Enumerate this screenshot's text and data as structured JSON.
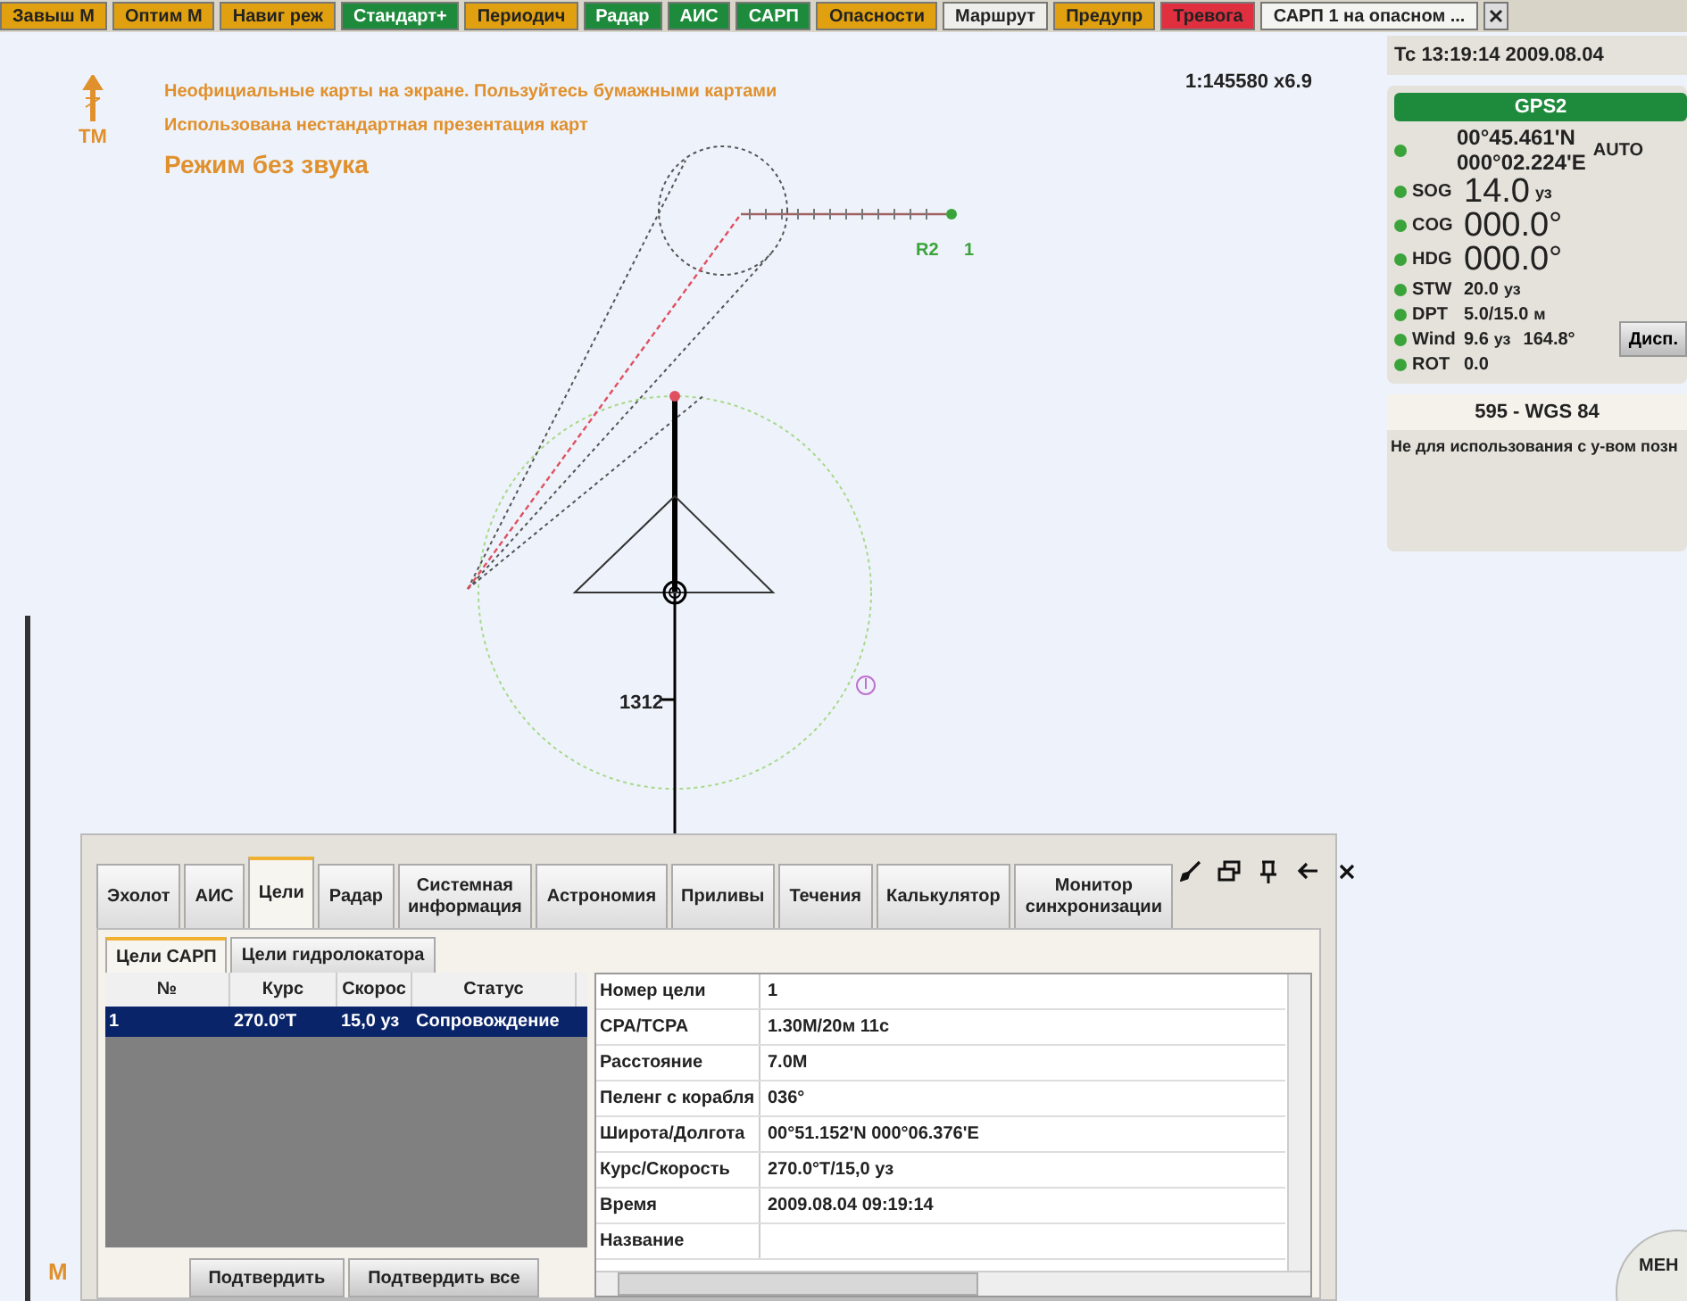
{
  "top_buttons": [
    {
      "label": "Завыш М",
      "color": "#e0a010"
    },
    {
      "label": "Оптим М",
      "color": "#e0a010"
    },
    {
      "label": "Навиг реж",
      "color": "#e0a010"
    },
    {
      "label": "Стандарт+",
      "color": "#1e8a3c"
    },
    {
      "label": "Периодич",
      "color": "#e0a010"
    },
    {
      "label": "Радар",
      "color": "#1e8a3c"
    },
    {
      "label": "АИС",
      "color": "#1e8a3c"
    },
    {
      "label": "САРП",
      "color": "#1e8a3c"
    },
    {
      "label": "Опасности",
      "color": "#e0a010"
    },
    {
      "label": "Маршрут",
      "color": "#eeeeea"
    },
    {
      "label": "Предупр",
      "color": "#e0a010"
    },
    {
      "label": "Тревога",
      "color": "#e03040"
    },
    {
      "label": "САРП 1 на опасном ...",
      "color": "#f4f4f0"
    }
  ],
  "chart": {
    "north_label": "ТМ",
    "warnings": [
      "Неофициальные карты на экране. Пользуйтесь бумажными картами",
      "Использована нестандартная презентация карт"
    ],
    "mode": "Режим без звука",
    "scale": "1:145580 x6.9",
    "route_name": "R2",
    "route_leg": "1",
    "range_label": "1312",
    "bottom_left": "M",
    "menu_label": "МЕН"
  },
  "nav_panel": {
    "clock": "Тс 13:19:14  2009.08.04",
    "sensor": "GPS2",
    "latitude": "00°45.461'N",
    "longitude": "000°02.224'E",
    "mode": "AUTO",
    "rows": [
      {
        "label": "SOG",
        "value": "14.0",
        "unit": "уз",
        "kind": "big"
      },
      {
        "label": "COG",
        "value": "000.0°",
        "kind": "big"
      },
      {
        "label": "HDG",
        "value": "000.0°",
        "kind": "big"
      },
      {
        "label": "STW",
        "value": "20.0",
        "unit": "уз",
        "kind": "small"
      },
      {
        "label": "DPT",
        "value": "5.0/15.0",
        "unit": "м",
        "kind": "small"
      },
      {
        "label": "Wind",
        "value": "9.6",
        "unit": "уз",
        "extra": "164.8°",
        "kind": "small"
      },
      {
        "label": "ROT",
        "value": "0.0",
        "kind": "small"
      }
    ],
    "display_button": "Дисп.",
    "datum": "595 - WGS 84",
    "note": "Не для использования с у-вом позн"
  },
  "targets_panel": {
    "tabs": [
      {
        "label": "Эхолот",
        "selected": false
      },
      {
        "label": "АИС",
        "selected": false
      },
      {
        "label": "Цели",
        "selected": true
      },
      {
        "label": "Радар",
        "selected": false
      },
      {
        "label": "Системная информация",
        "selected": false
      },
      {
        "label": "Астрономия",
        "selected": false
      },
      {
        "label": "Приливы",
        "selected": false
      },
      {
        "label": "Течения",
        "selected": false
      },
      {
        "label": "Калькулятор",
        "selected": false
      },
      {
        "label": "Монитор синхронизации",
        "selected": false
      }
    ],
    "subtabs": [
      {
        "label": "Цели САРП",
        "selected": true
      },
      {
        "label": "Цели гидролокатора",
        "selected": false
      }
    ],
    "table": {
      "columns": [
        "№",
        "Курс",
        "Скорос",
        "Статус"
      ],
      "rows": [
        {
          "cells": [
            "1",
            "270.0°T",
            "15,0 уз",
            "Сопровождение"
          ],
          "selected": true
        }
      ]
    },
    "details": [
      {
        "label": "Номер цели",
        "value": "1"
      },
      {
        "label": "CPA/TCPA",
        "value": "1.30M/20м 11с"
      },
      {
        "label": "Расстояние",
        "value": "7.0M"
      },
      {
        "label": "Пеленг с корабля",
        "value": "036°"
      },
      {
        "label": "Широта/Долгота",
        "value": "00°51.152'N 000°06.376'E"
      },
      {
        "label": "Курс/Скорость",
        "value": "270.0°T/15,0 уз"
      },
      {
        "label": "Время",
        "value": "2009.08.04 09:19:14"
      },
      {
        "label": "Название"
      }
    ],
    "buttons": [
      "Подтвердить",
      "Подтвердить все"
    ]
  }
}
